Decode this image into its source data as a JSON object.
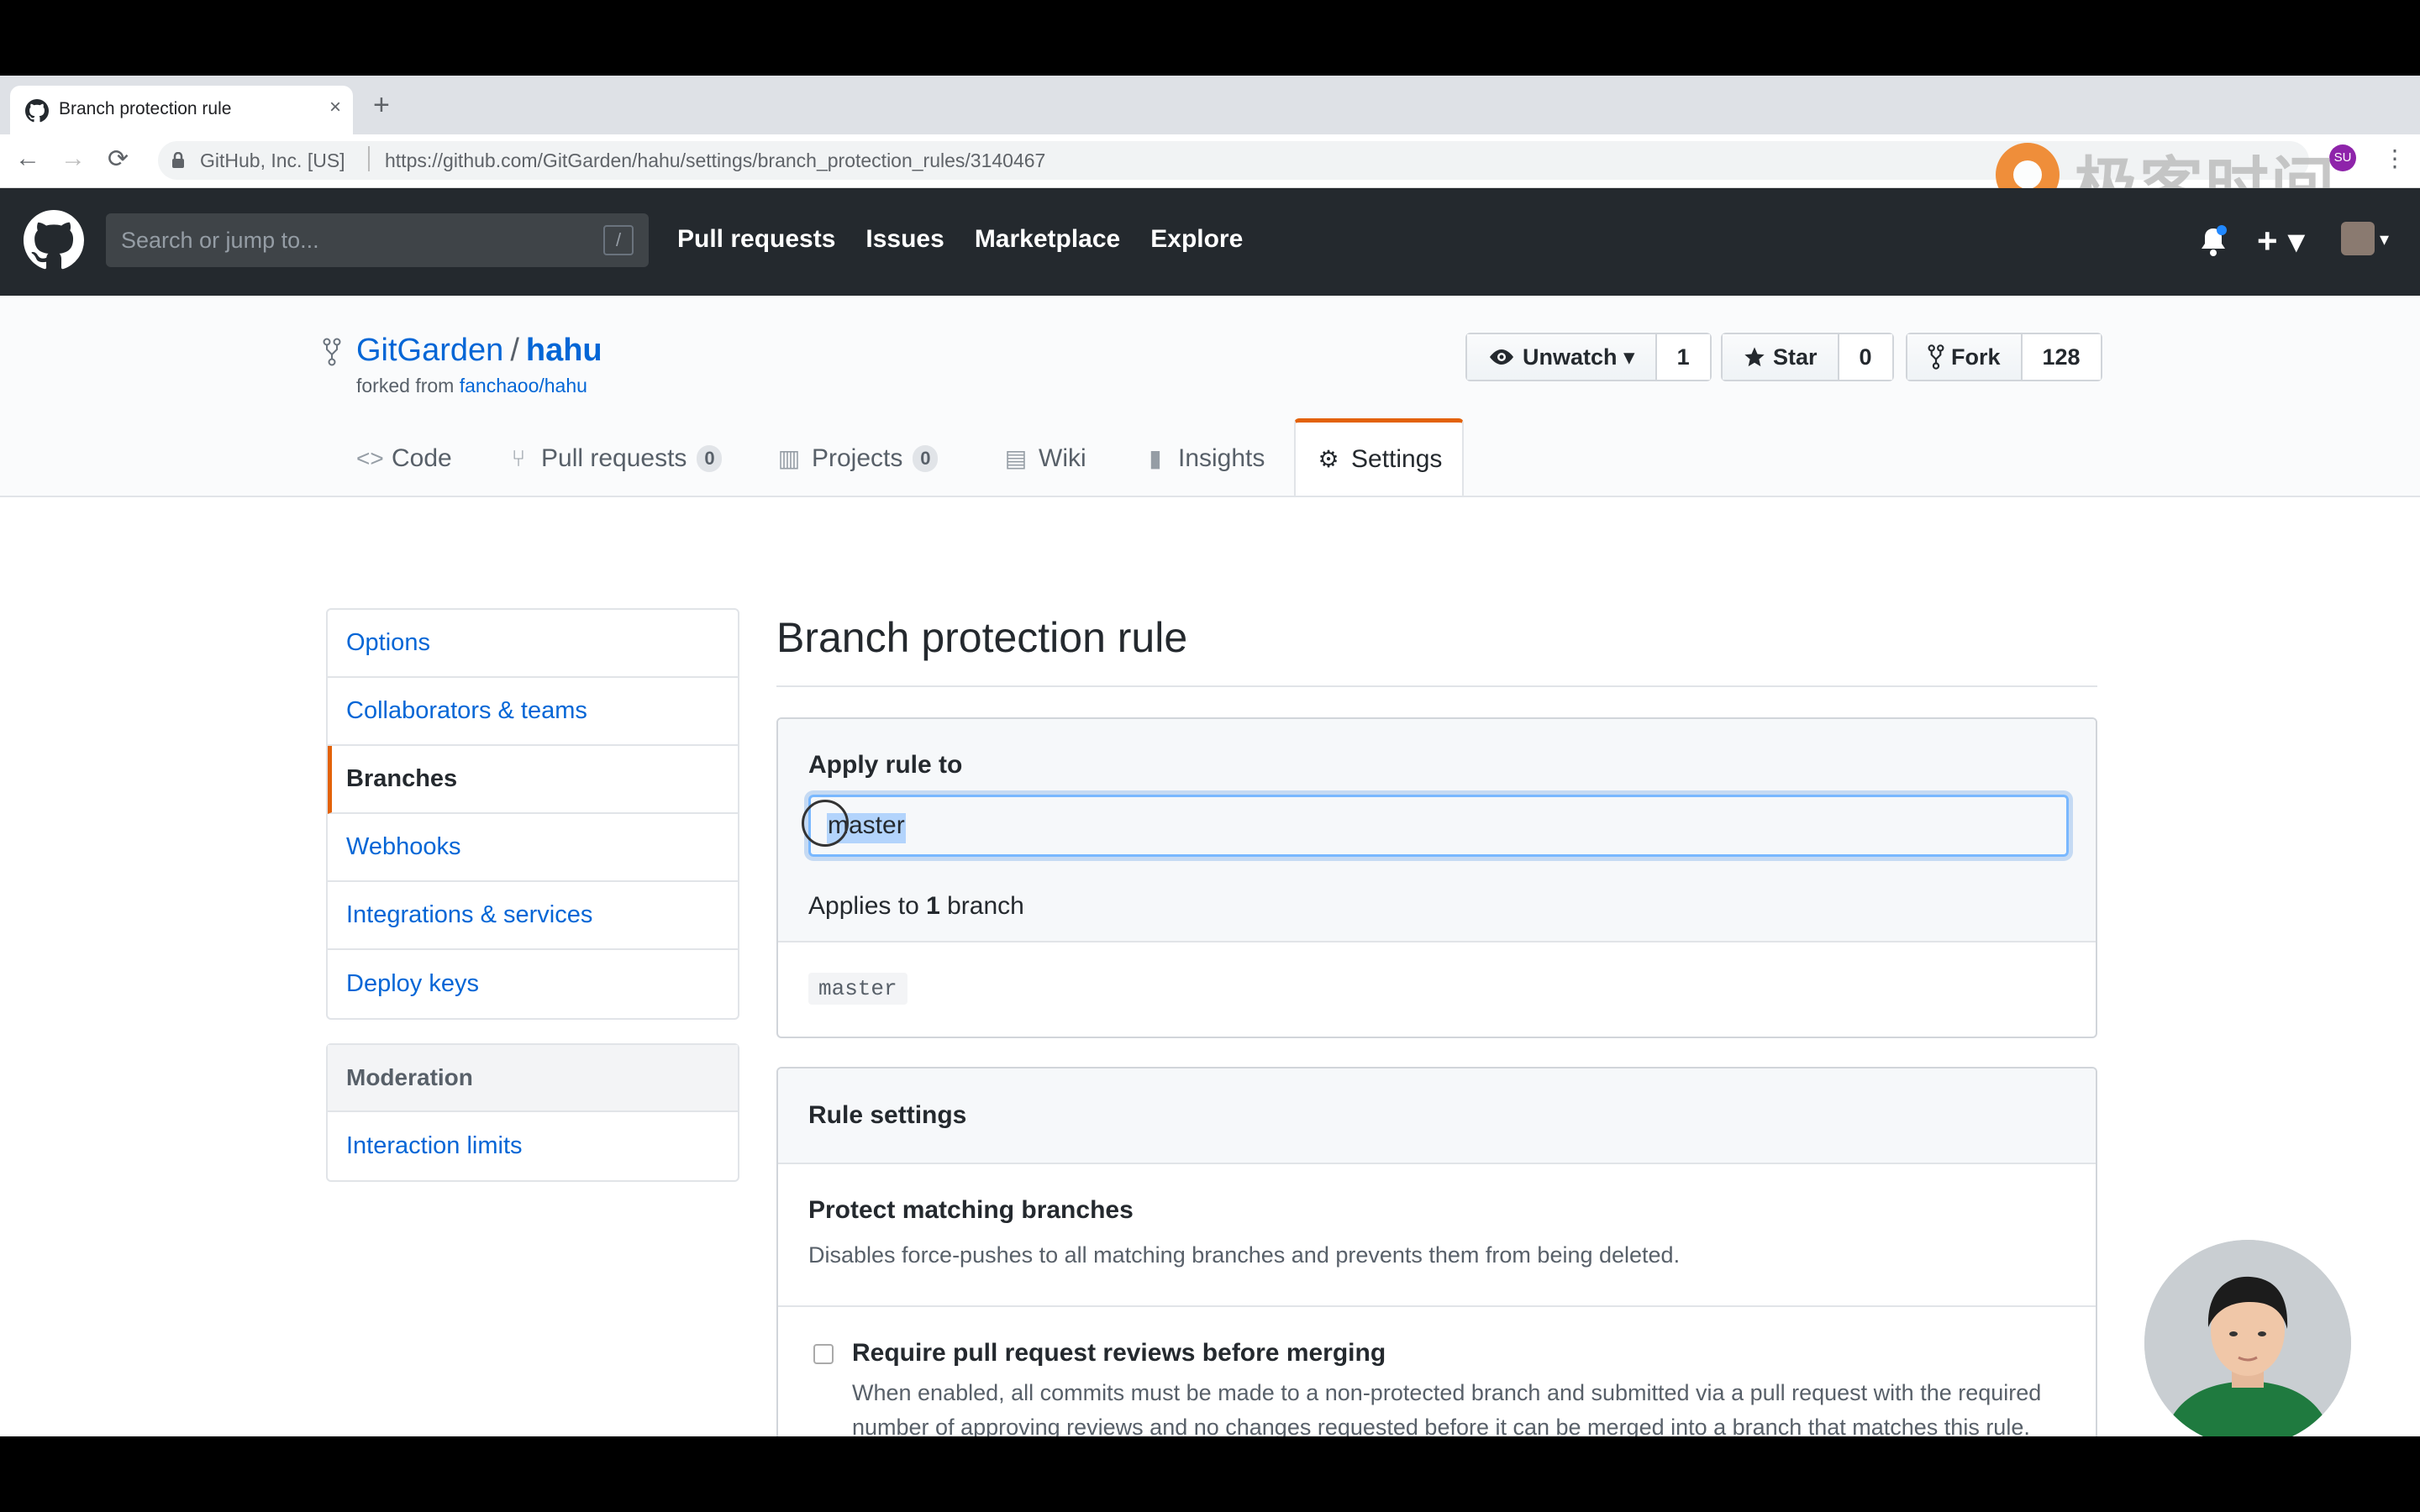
{
  "browser": {
    "tab_title": "Branch protection rule",
    "tab_close": "×",
    "new_tab": "+",
    "back": "←",
    "forward": "→",
    "reload": "⟳",
    "site_org": "GitHub, Inc. [US]",
    "url": "https://github.com/GitGarden/hahu/settings/branch_protection_rules/3140467",
    "extension_badge": "SU",
    "menu": "⋮"
  },
  "watermark": {
    "text": "极客时间"
  },
  "header": {
    "search_placeholder": "Search or jump to...",
    "slash": "/",
    "nav": [
      "Pull requests",
      "Issues",
      "Marketplace",
      "Explore"
    ],
    "plus": "+ ▾",
    "avatar_caret": "▾"
  },
  "repo": {
    "owner": "GitGarden",
    "separator": "/",
    "name": "hahu",
    "forked_prefix": "forked from ",
    "forked_link": "fanchaoo/hahu",
    "unwatch_label": "Unwatch ▾",
    "watch_count": "1",
    "star_label": "Star",
    "star_count": "0",
    "fork_label": "Fork",
    "fork_count": "128",
    "tabs": [
      {
        "icon": "<>",
        "label": "Code"
      },
      {
        "icon": "⑂",
        "label": "Pull requests",
        "count": "0"
      },
      {
        "icon": "▥",
        "label": "Projects",
        "count": "0"
      },
      {
        "icon": "▤",
        "label": "Wiki"
      },
      {
        "icon": "▮",
        "label": "Insights"
      },
      {
        "icon": "⚙",
        "label": "Settings"
      }
    ]
  },
  "sidebar": {
    "items": [
      "Options",
      "Collaborators & teams",
      "Branches",
      "Webhooks",
      "Integrations & services",
      "Deploy keys"
    ],
    "moderation_heading": "Moderation",
    "moderation_items": [
      "Interaction limits"
    ]
  },
  "main": {
    "title": "Branch protection rule",
    "apply_label": "Apply rule to",
    "pattern_value": "master",
    "applies_prefix": "Applies to ",
    "applies_count": "1",
    "applies_suffix": " branch",
    "matched_branch": "master",
    "rule_settings": "Rule settings",
    "protect_title": "Protect matching branches",
    "protect_desc": "Disables force-pushes to all matching branches and prevents them from being deleted.",
    "require_reviews_title": "Require pull request reviews before merging",
    "require_reviews_desc": "When enabled, all commits must be made to a non-protected branch and submitted via a pull request with the required number of approving reviews and no changes requested before it can be merged into a branch that matches this rule."
  }
}
